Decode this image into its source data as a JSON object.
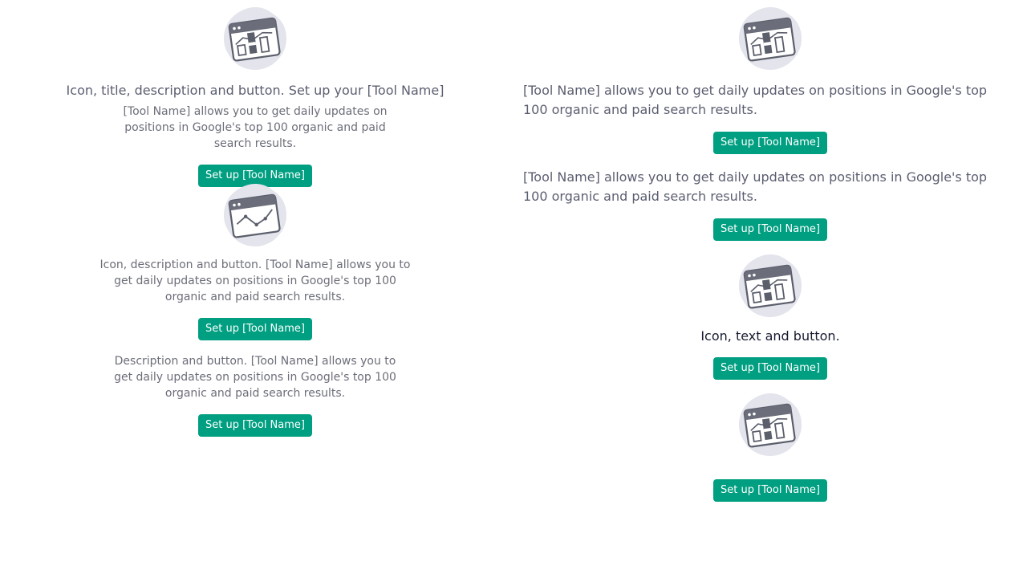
{
  "colors": {
    "button": "#009f81",
    "title": "#5b5e70",
    "description": "#6c6e79",
    "plain_text": "#171b30"
  },
  "left": {
    "block1": {
      "icon": "bar-chart-browser-illustration",
      "title": "Icon, title, description and button. Set up your [Tool Name]",
      "description": "[Tool Name] allows you to get daily updates on positions in Google's top 100 organic and paid search results.",
      "button": "Set up [Tool Name]"
    },
    "block2": {
      "icon": "line-chart-browser-illustration",
      "description": "Icon, description and button. [Tool Name] allows you to get daily updates on positions in Google's top 100 organic and paid search results.",
      "button": "Set up [Tool Name]"
    },
    "block3": {
      "description": "Description and button. [Tool Name] allows you to get daily updates on positions in Google's top 100 organic and paid search results.",
      "button": "Set up [Tool Name]"
    }
  },
  "right": {
    "block1": {
      "icon": "bar-chart-browser-illustration",
      "description": "[Tool Name] allows you to get daily updates on positions in Google's top 100 organic and paid search results.",
      "button": "Set up [Tool Name]"
    },
    "block2": {
      "description": "[Tool Name] allows you to get daily updates on positions in Google's top 100 organic and paid search results.",
      "button": "Set up [Tool Name]"
    },
    "block3": {
      "icon": "bar-chart-browser-illustration",
      "text": "Icon, text and button.",
      "button": "Set up [Tool Name]"
    },
    "block4": {
      "icon": "bar-chart-browser-illustration",
      "button": "Set up [Tool Name]"
    }
  }
}
